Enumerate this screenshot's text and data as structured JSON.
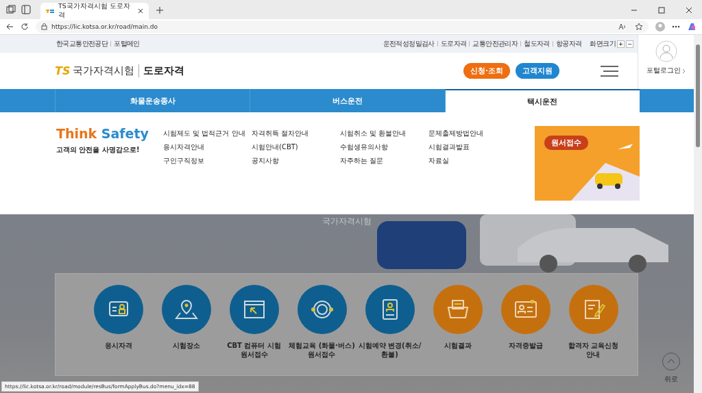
{
  "browser": {
    "tab_title": "TS국가자격시험 도로자격",
    "url": "https://lic.kotsa.or.kr/road/main.do",
    "status_url": "https://lic.kotsa.or.kr/road/module/resBus/formApplyBus.do?menu_idx=88"
  },
  "utility_bar": {
    "left_links": [
      "한국교통안전공단",
      "포털메인"
    ],
    "right_links": [
      "운전적성정밀검사",
      "도로자격",
      "교통안전관리자",
      "철도자격",
      "항공자격"
    ],
    "font_size_label": "화면크기",
    "font_size_buttons": [
      "+",
      "−"
    ]
  },
  "header": {
    "logo_mark": "TS",
    "logo_title": "국가자격시험",
    "logo_subtitle": "도로자격",
    "buttons": [
      {
        "label": "신청·조회",
        "color": "#ee6e12"
      },
      {
        "label": "고객지원",
        "color": "#1f86cf"
      }
    ],
    "portal_login": "포털로그인"
  },
  "nav_tabs": [
    {
      "label": "화물운송종사",
      "selected": false
    },
    {
      "label": "버스운전",
      "selected": false
    },
    {
      "label": "택시운전",
      "selected": true
    }
  ],
  "mega_menu": {
    "slogan_first": "Think",
    "slogan_second": "Safety",
    "tagline": "고객의 안전을 사명감으로!",
    "columns": [
      [
        "시험제도 및 법적근거 안내",
        "응시자격안내",
        "구인구직정보"
      ],
      [
        "자격취득 절차안내",
        "시험안내(CBT)",
        "공지사항"
      ],
      [
        "시험취소 및 환불안내",
        "수험생유의사항",
        "자주하는 질문"
      ],
      [
        "문제출제방법안내",
        "시험결과발표",
        "자료실"
      ]
    ],
    "banner_label": "원서접수"
  },
  "hero": {
    "caption": "국가자격시험"
  },
  "quick_links": [
    {
      "label": "응시자격",
      "color": "#0e5f8f"
    },
    {
      "label": "시험장소",
      "color": "#0e5f8f"
    },
    {
      "label": "CBT 컴퓨터 시험\n원서접수",
      "color": "#0e5f8f"
    },
    {
      "label": "체험교육 (화물·버스)\n원서접수",
      "color": "#0e5f8f"
    },
    {
      "label": "시험예약 변경(취소/\n환불)",
      "color": "#0e5f8f"
    },
    {
      "label": "시험결과",
      "color": "#c5700f"
    },
    {
      "label": "자격증발급",
      "color": "#c5700f"
    },
    {
      "label": "합격자 교육신청\n안내",
      "color": "#c5700f"
    }
  ],
  "top_button": "위로"
}
